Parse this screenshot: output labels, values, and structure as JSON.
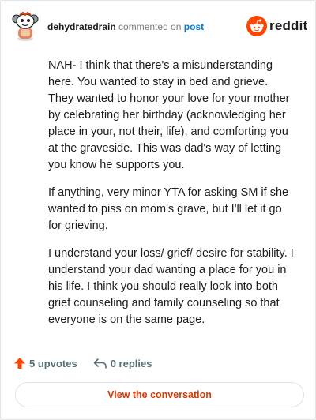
{
  "comment": {
    "author": "dehydratedrain",
    "action_text": "commented on",
    "post_link": "post",
    "paragraphs": [
      "NAH- I think that there's a misunderstanding here. You wanted to stay in bed and grieve. They wanted to honor your love for your mother by celebrating her birthday (acknowledging her place in your, not their, life), and comforting you at the graveside. This was dad's way of letting you know he supports you.",
      "If anything, very minor YTA for asking SM if she wanted to piss on mom's grave, but I'll let it go for grieving.",
      "I understand your loss/ grief/ desire for stability. I understand your dad wanting a place for you in his life. I think you should really look into both grief counseling and family counseling so that everyone is on the same page."
    ]
  },
  "brand": {
    "wordmark": "reddit",
    "logo_icon": "reddit-snoo-icon",
    "accent": "#ff4500"
  },
  "footer": {
    "upvotes_label": "5 upvotes",
    "replies_label": "0 replies",
    "upvote_icon": "upvote-arrow-icon",
    "reply_icon": "reply-arrow-icon",
    "upvote_color": "#ff4500"
  },
  "view_button": {
    "label": "View the conversation",
    "color": "#d93a00"
  }
}
